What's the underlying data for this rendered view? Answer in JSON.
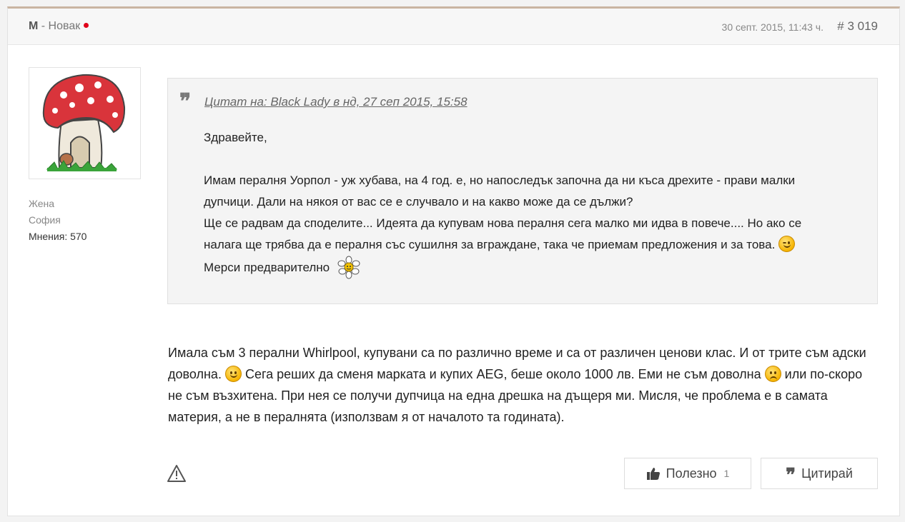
{
  "header": {
    "author_initial": "М",
    "author_separator": " - ",
    "author_rank": "Новак",
    "date": "30 септ. 2015, 11:43 ч.",
    "post_number": "# 3 019"
  },
  "user": {
    "gender": "Жена",
    "city": "София",
    "posts_count": "Мнения: 570"
  },
  "quote": {
    "source": "Цитат на: Black Lady в нд, 27 сеп 2015, 15:58",
    "lines": [
      "Здравейте,",
      "Имам пералня Уорпол - уж хубава, на 4 год. е, но напоследък започна да ни къса дрехите - прави малки",
      "дупчици. Дали на някоя от вас се е случвало и на какво може да се дължи?",
      "Ще се радвам да споделите... Идеята да купувам нова пералня сега  малко ми идва в повече.... Но ако се",
      "налага ще трябва да е пералня със сушилня за вграждане, така че приемам предложения и за това.",
      "Мерси предварително"
    ]
  },
  "body": {
    "part1": "Имала съм 3 перални Whirlpool,  купувани са по различно време и са от различен ценови клас. И от трите съм адски доволна.",
    "part2": " Сега реших да сменя марката и купих AEG, беше около 1000 лв. Еми не съм доволна",
    "part3": " или по-скоро не съм възхитена. При нея се получи дупчица на една дрешка на дъщеря ми. Мисля, че проблема е в самата материя, а не в пералнята  (използвам я от началото та годината)."
  },
  "actions": {
    "useful_label": "Полезно",
    "useful_count": "1",
    "quote_label": "Цитирай"
  },
  "colors": {
    "header_border": "#c9b4a1",
    "online_dot": "#e0001a",
    "quote_bg": "#f4f4f4"
  },
  "icons": [
    "quote-mark-icon",
    "thumbs-up-icon",
    "warning-icon",
    "smile-icon",
    "wink-icon",
    "sad-icon",
    "daisy-icon",
    "mushroom-avatar"
  ]
}
